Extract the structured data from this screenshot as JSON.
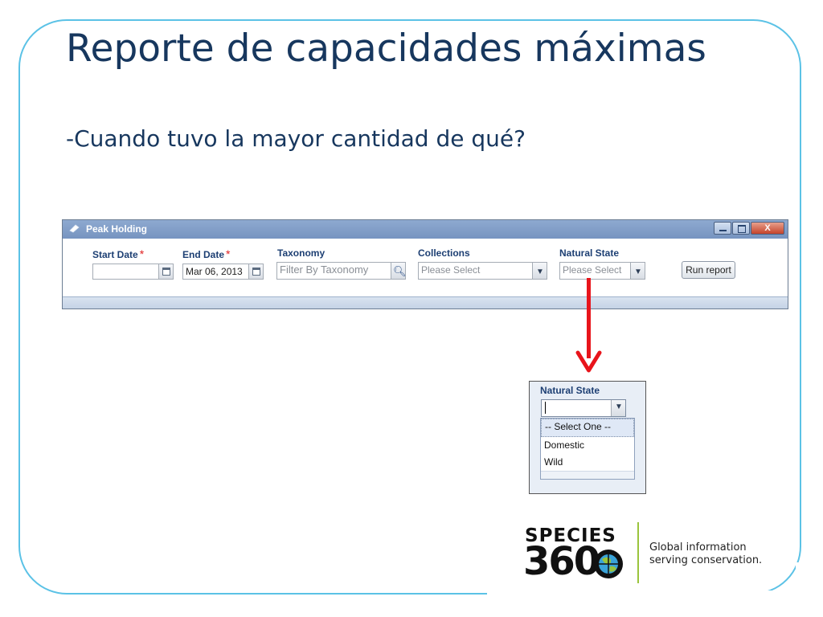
{
  "slide": {
    "title": "Reporte de capacidades máximas",
    "subtitle": "-Cuando tuvo la mayor cantidad de qué?"
  },
  "window": {
    "title": "Peak Holding",
    "close_glyph": "X",
    "fields": {
      "start_date": {
        "label": "Start Date",
        "required_mark": "*",
        "value": ""
      },
      "end_date": {
        "label": "End Date",
        "required_mark": "*",
        "value": "Mar 06, 2013"
      },
      "taxonomy": {
        "label": "Taxonomy",
        "placeholder": "Filter By Taxonomy"
      },
      "collections": {
        "label": "Collections",
        "placeholder": "Please Select"
      },
      "natural_state": {
        "label": "Natural State",
        "placeholder": "Please Select"
      }
    },
    "run_button": "Run report"
  },
  "dropdown_zoom": {
    "label": "Natural State",
    "options": [
      "-- Select One --",
      "Domestic",
      "Wild"
    ],
    "selected": "-- Select One --"
  },
  "logo": {
    "line1": "SPECIES",
    "line2": "360",
    "tagline_line1": "Global information",
    "tagline_line2": "serving conservation."
  },
  "colors": {
    "title": "#17375e",
    "frame": "#5bc2e6",
    "arrow": "#e8141b",
    "logo_divider": "#9ac43c"
  },
  "icons": [
    "app-icon",
    "minimize-icon",
    "maximize-icon",
    "close-icon",
    "calendar-icon",
    "search-icon",
    "chevron-down-icon",
    "globe-icon",
    "arrow-down-icon"
  ]
}
